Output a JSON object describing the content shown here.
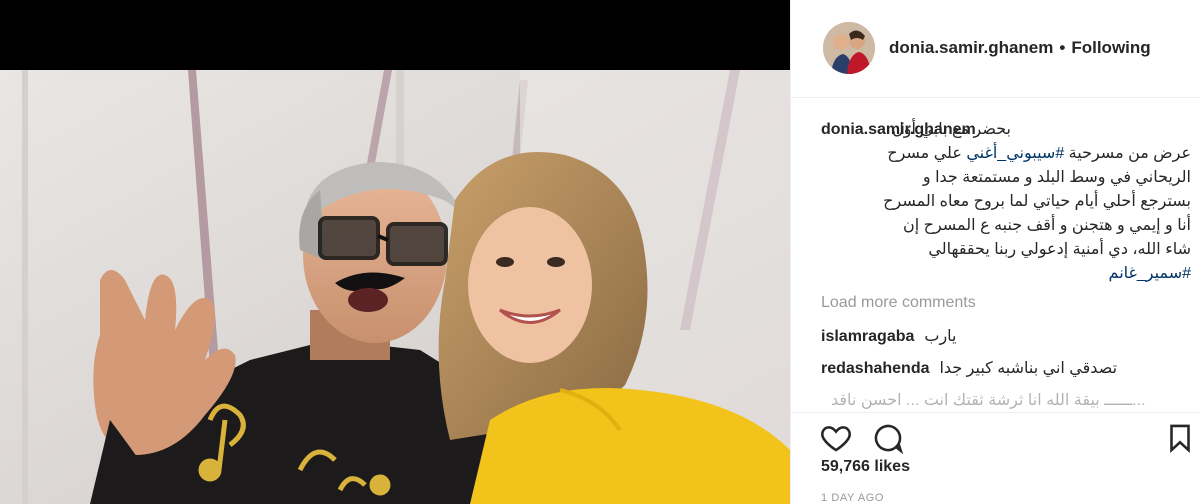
{
  "post": {
    "username": "donia.samir.ghanem",
    "follow_status": "Following",
    "separator": "•"
  },
  "caption": {
    "username": "donia.samir.ghanem",
    "lines": [
      "بحضر مع بابي أول",
      "عرض من مسرحية  ",
      "الريحاني في وسط البلد و مستمتعة جدا و",
      "بسترجع أحلي أيام حياتي لما بروح معاه المسرح",
      "أنا و إيمي و هتجنن و أقف جنبه ع المسرح إن",
      "شاء الله، دي أمنية إدعولي ربنا يحققهالي"
    ],
    "line2_hashtag": "#سيبوني_أغني",
    "line2_tail": " علي مسرح",
    "hashtag_final": "#سمير_غانم"
  },
  "load_more": "Load more comments",
  "comments": [
    {
      "user": "islamragaba",
      "text": "يارب"
    },
    {
      "user": "redashahenda",
      "text": "تصدقي اني بناشبه كبير جدا"
    },
    {
      "user": "",
      "text": "...ــــــ بيقة الله انا ثرشة ثقتك انت ... احسن ناقد"
    }
  ],
  "likes": "59,766 likes",
  "timestamp": "1 DAY AGO",
  "colors": {
    "hashtag": "#003569",
    "muted": "#999999",
    "text": "#262626",
    "border": "#efefef"
  },
  "icons": [
    "heart-icon",
    "comment-icon",
    "bookmark-icon"
  ]
}
